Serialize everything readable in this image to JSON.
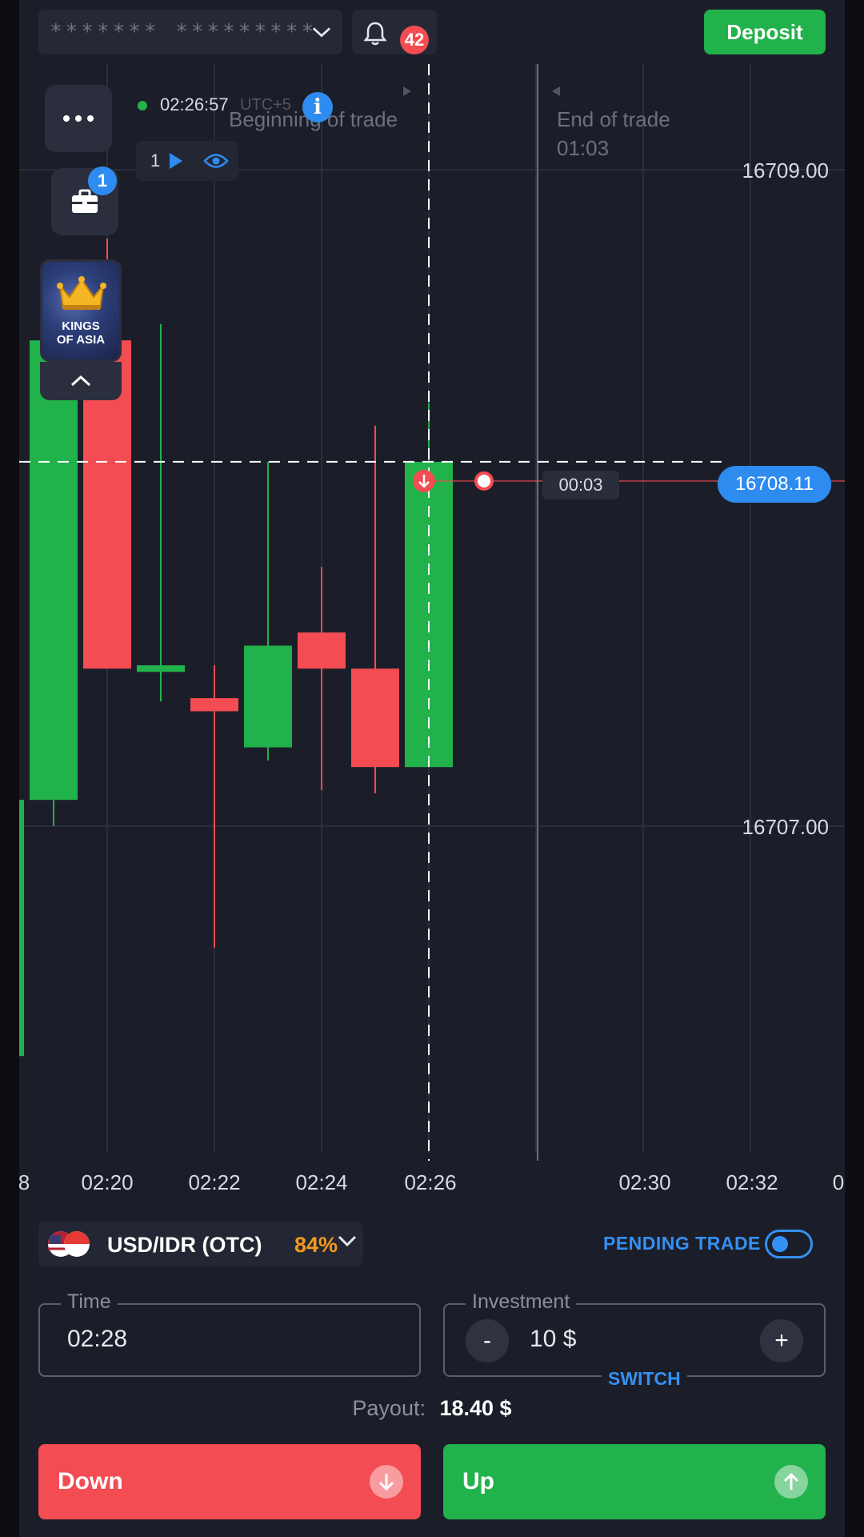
{
  "header": {
    "account_mask": "******* *********",
    "notifications_count": "42",
    "deposit_label": "Deposit"
  },
  "chart_overlay": {
    "clock": "02:26:57",
    "utc_label": "UTC+5",
    "beginning_label": "Beginning of trade",
    "end_label": "End of trade",
    "end_time": "01:03",
    "open_trades_count": "1",
    "portfolio_count": "1",
    "timer": "00:03",
    "current_price": "16708.11",
    "promo_line1": "KINGS",
    "promo_line2": "OF ASIA"
  },
  "chart_data": {
    "type": "candlestick",
    "y_ticks": [
      "16709.00",
      "16707.00"
    ],
    "x_ticks": [
      "8",
      "02:20",
      "02:22",
      "02:24",
      "02:26",
      "02:30",
      "02:32",
      "0"
    ],
    "current_price": 16708.11,
    "candles": [
      {
        "open": 16707.08,
        "close": 16708.48,
        "high": 16708.48,
        "low": 16707.0,
        "dir": "up"
      },
      {
        "open": 16708.48,
        "close": 16707.48,
        "high": 16708.79,
        "low": 16707.48,
        "dir": "down"
      },
      {
        "open": 16707.49,
        "close": 16707.47,
        "high": 16708.53,
        "low": 16707.38,
        "dir": "up"
      },
      {
        "open": 16707.39,
        "close": 16707.35,
        "high": 16707.49,
        "low": 16706.63,
        "dir": "down"
      },
      {
        "open": 16707.24,
        "close": 16707.55,
        "high": 16708.11,
        "low": 16707.2,
        "dir": "up"
      },
      {
        "open": 16707.59,
        "close": 16707.48,
        "high": 16707.79,
        "low": 16707.11,
        "dir": "down"
      },
      {
        "open": 16707.48,
        "close": 16707.18,
        "high": 16708.22,
        "low": 16707.1,
        "dir": "down"
      },
      {
        "open": 16707.18,
        "close": 16708.11,
        "high": 16708.29,
        "low": 16707.18,
        "dir": "up"
      }
    ],
    "colors": {
      "up": "#21b24b",
      "down": "#f34c52",
      "grid": "#2a2e3b",
      "price_line": "#ffffff"
    }
  },
  "asset": {
    "name": "USD/IDR (OTC)",
    "payout_pct": "84%"
  },
  "pending_trade_label": "PENDING TRADE",
  "time_field": {
    "label": "Time",
    "value": "02:28"
  },
  "investment_field": {
    "label": "Investment",
    "value": "10 $",
    "minus": "-",
    "plus": "+",
    "switch_label": "SWITCH"
  },
  "payout": {
    "label": "Payout:",
    "value": "18.40 $"
  },
  "buttons": {
    "down": "Down",
    "up": "Up"
  },
  "icons": [
    "chevron-down-icon",
    "bell-icon",
    "menu-dots-icon",
    "info-icon",
    "play-icon",
    "eye-icon",
    "briefcase-icon",
    "crown-icon",
    "chevron-up-icon",
    "arrow-down-icon",
    "arrow-up-icon"
  ]
}
